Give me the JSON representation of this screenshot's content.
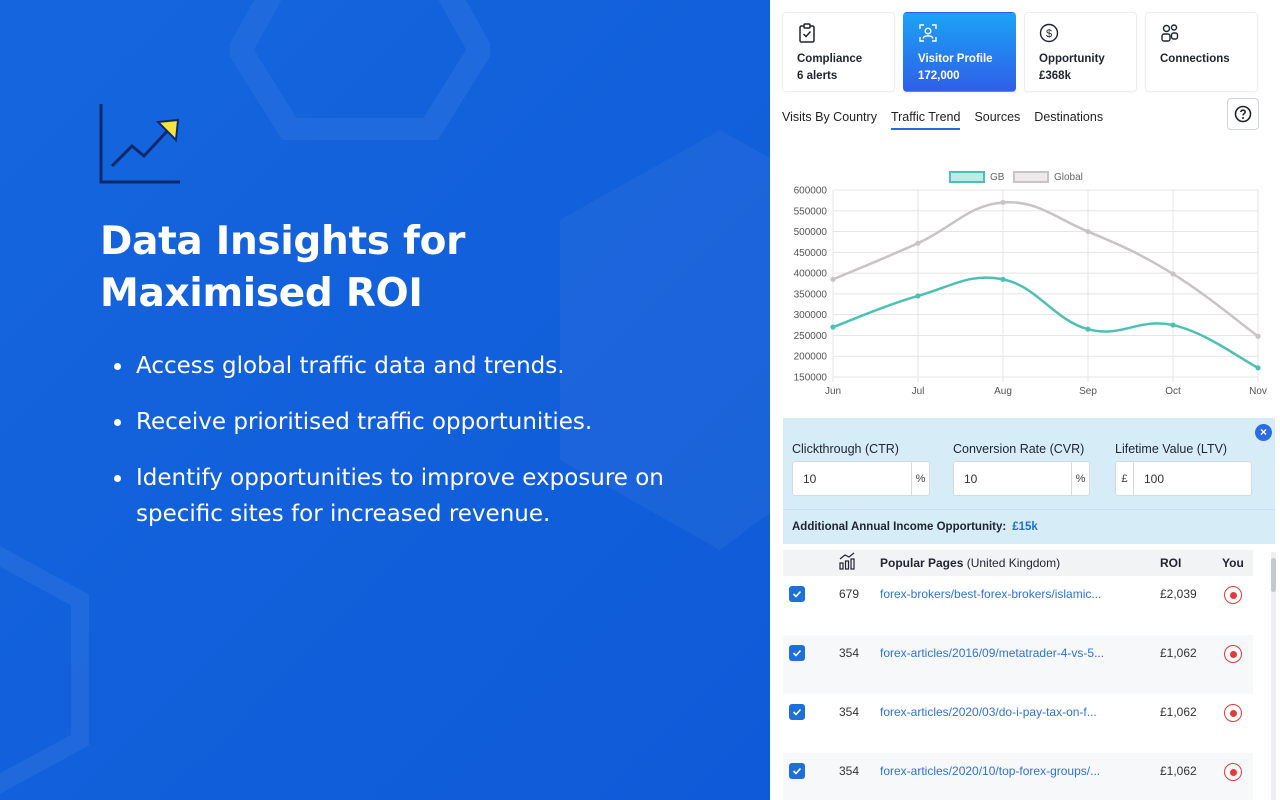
{
  "promo": {
    "headline_line1": "Data Insights for",
    "headline_line2": "Maximised ROI",
    "bullets": [
      "Access global traffic data and trends.",
      "Receive prioritised traffic opportunities.",
      "Identify opportunities to improve exposure on specific sites for increased revenue."
    ],
    "icon": "trend-arrow-icon"
  },
  "cards": [
    {
      "title": "Compliance",
      "value": "6 alerts",
      "icon": "clipboard-check-icon",
      "active": false
    },
    {
      "title": "Visitor Profile",
      "value": "172,000",
      "icon": "user-icon",
      "active": true
    },
    {
      "title": "Opportunity",
      "value": "£368k",
      "icon": "dollar-circle-icon",
      "active": false
    },
    {
      "title": "Connections",
      "value": "",
      "icon": "people-icon",
      "active": false
    }
  ],
  "tabs": [
    {
      "label": "Visits By Country",
      "active": false
    },
    {
      "label": "Traffic Trend",
      "active": true
    },
    {
      "label": "Sources",
      "active": false
    },
    {
      "label": "Destinations",
      "active": false
    }
  ],
  "chart_data": {
    "type": "line",
    "categories": [
      "Jun",
      "Jul",
      "Aug",
      "Sep",
      "Oct",
      "Nov"
    ],
    "series": [
      {
        "name": "GB",
        "values": [
          270000,
          345000,
          385000,
          265000,
          275000,
          172000
        ],
        "color": "#4dc0b5"
      },
      {
        "name": "Global",
        "values": [
          385000,
          472000,
          570000,
          500000,
          398000,
          248000
        ],
        "color": "#c9c3c6"
      }
    ],
    "ylim": [
      150000,
      600000
    ],
    "yticks": [
      "600000",
      "550000",
      "500000",
      "450000",
      "400000",
      "350000",
      "300000",
      "250000",
      "200000",
      "150000"
    ],
    "legend": "top",
    "grid": true
  },
  "calculator": {
    "ctr_label": "Clickthrough (CTR)",
    "ctr_value": "10",
    "ctr_unit": "%",
    "cvr_label": "Conversion Rate (CVR)",
    "cvr_value": "10",
    "cvr_unit": "%",
    "ltv_label": "Lifetime Value (LTV)",
    "ltv_currency": "£",
    "ltv_value": "100",
    "income_label": "Additional Annual Income Opportunity:",
    "income_value": "£15k",
    "close": "×"
  },
  "table": {
    "header_pages": "Popular Pages",
    "header_region": "(United Kingdom)",
    "header_roi": "ROI",
    "header_you": "You",
    "rows": [
      {
        "count": "679",
        "page": "forex-brokers/best-forex-brokers/islamic...",
        "roi": "£2,039"
      },
      {
        "count": "354",
        "page": "forex-articles/2016/09/metatrader-4-vs-5...",
        "roi": "£1,062"
      },
      {
        "count": "354",
        "page": "forex-articles/2020/03/do-i-pay-tax-on-f...",
        "roi": "£1,062"
      },
      {
        "count": "354",
        "page": "forex-articles/2020/10/top-forex-groups/...",
        "roi": "£1,062"
      }
    ]
  },
  "colors": {
    "brand_blue": "#1461dc",
    "accent": "#1e6fd9",
    "gb_line": "#4dc0b5",
    "global_line": "#c9c3c6",
    "alert_red": "#e03b3b"
  }
}
